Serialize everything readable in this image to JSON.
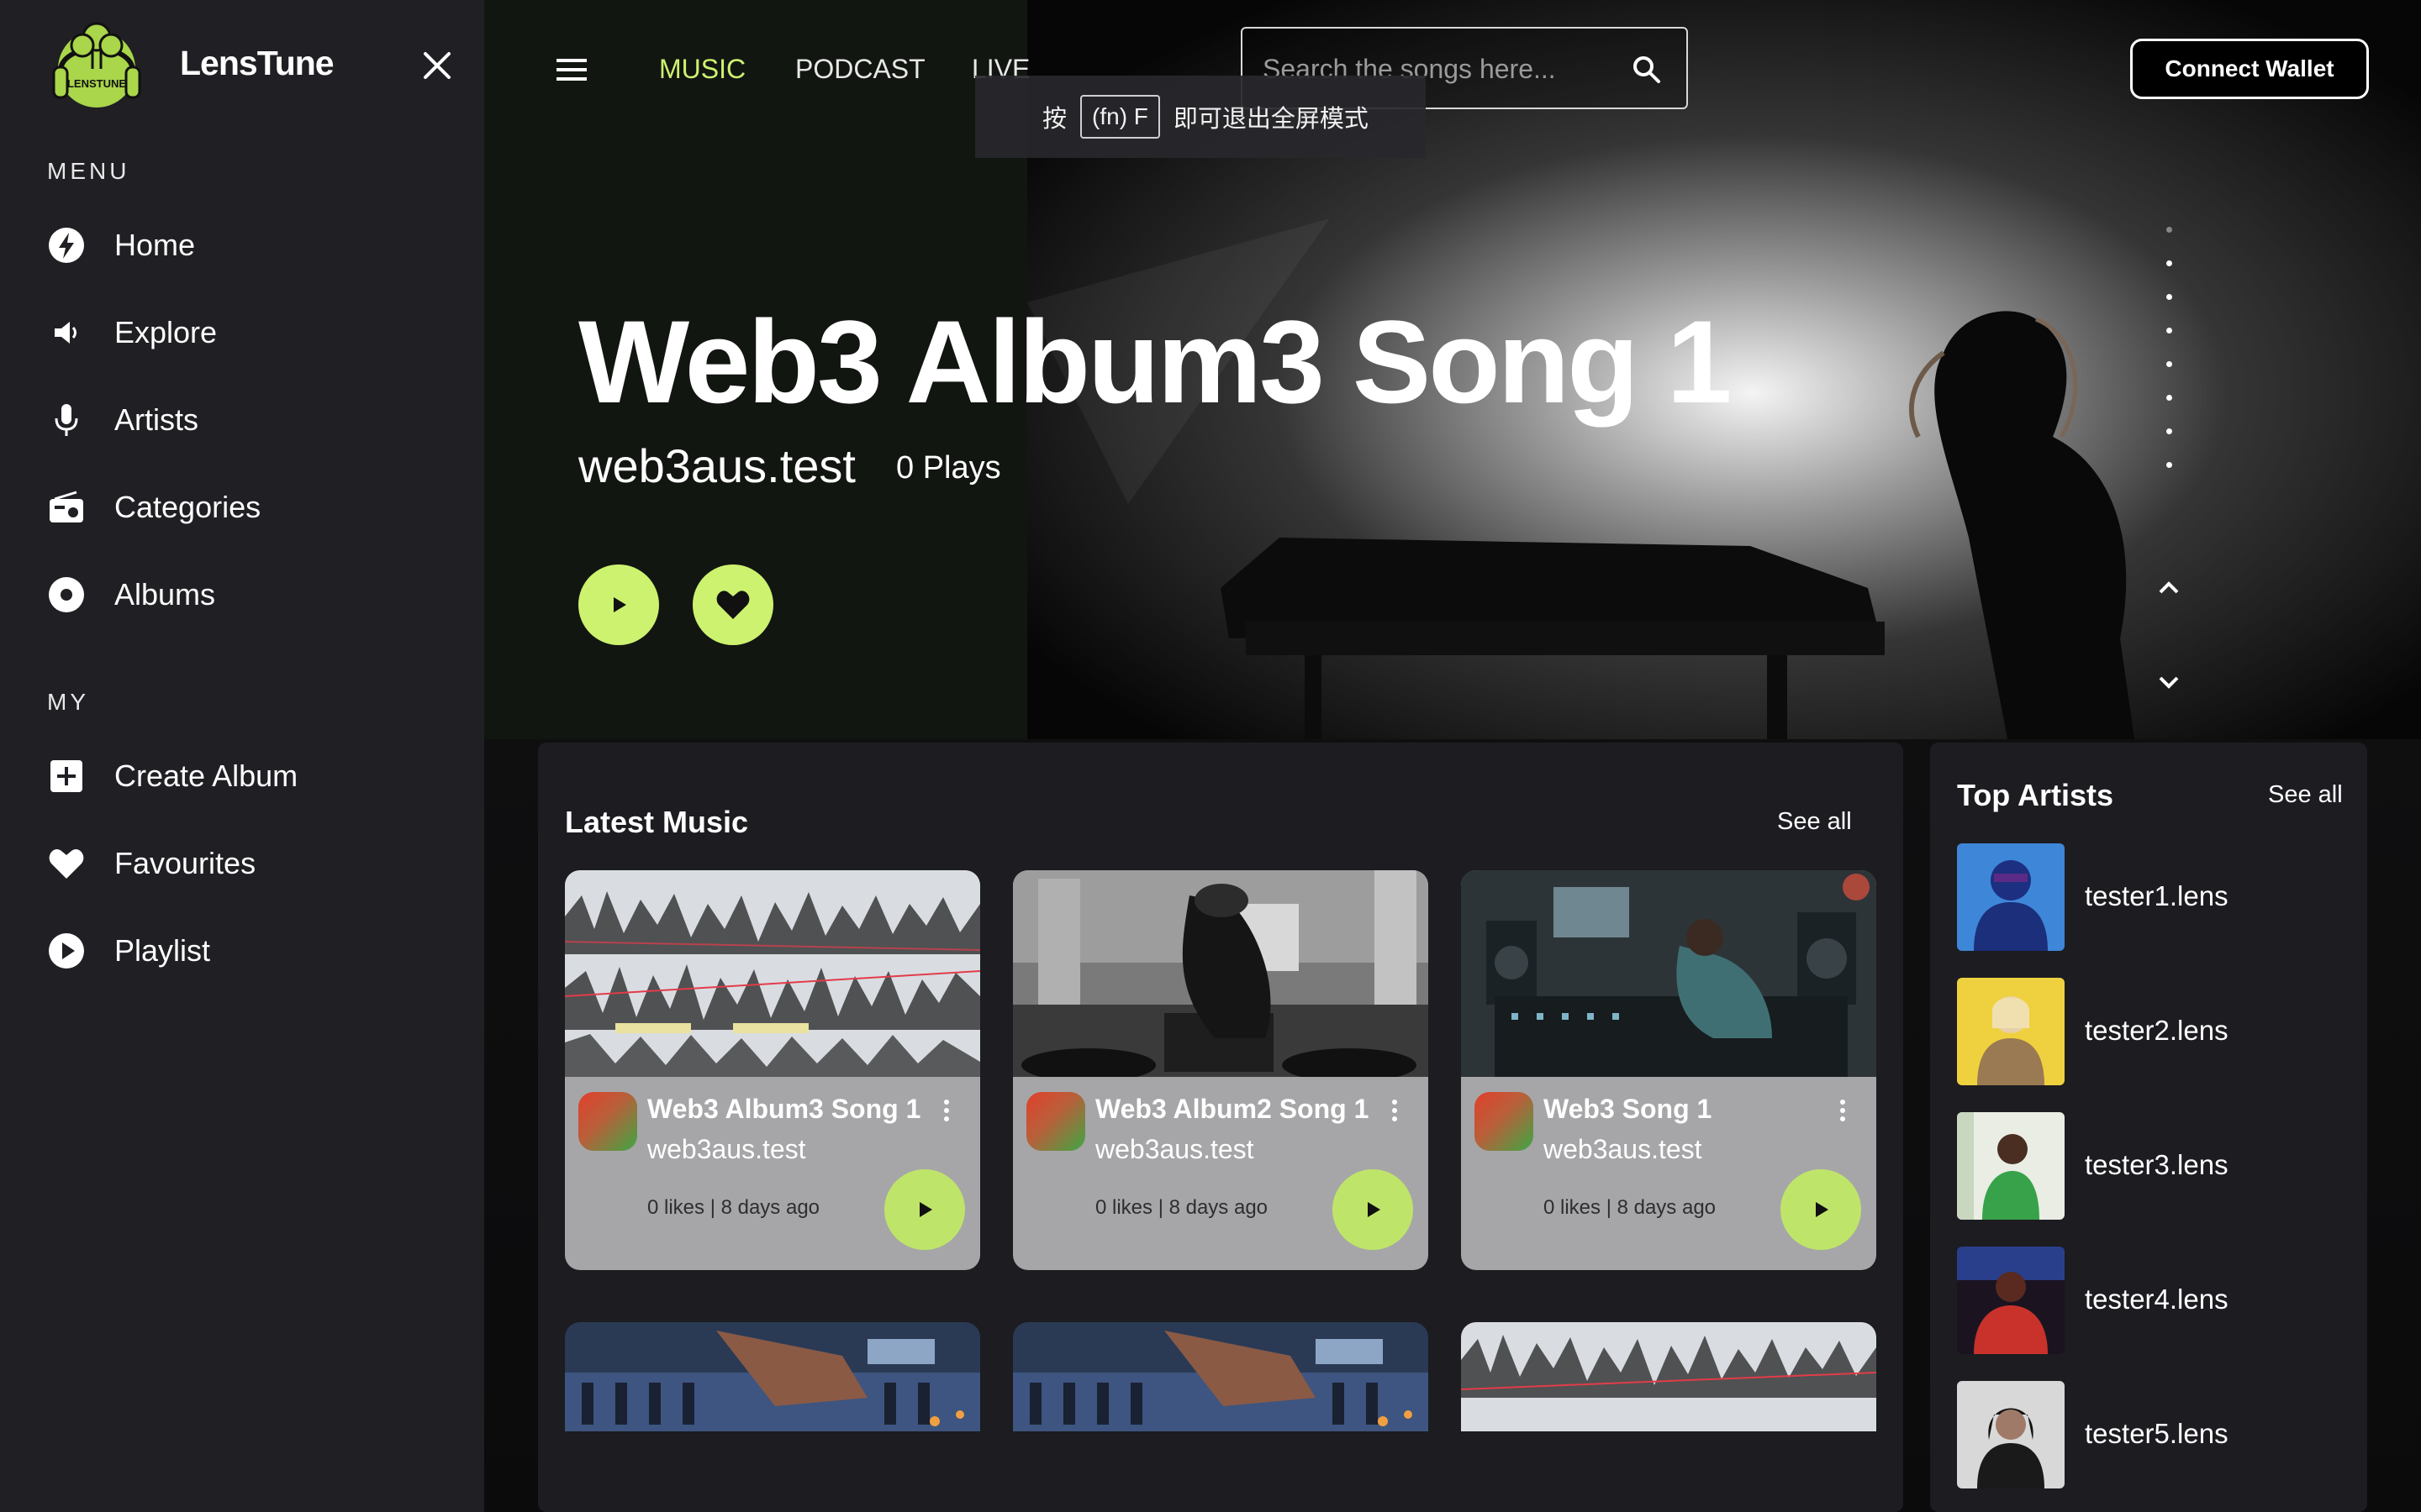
{
  "app": {
    "brand": "LensTune",
    "logo_text": "LENSTUNE"
  },
  "sidebar": {
    "menu_label": "MENU",
    "menu_items": [
      {
        "label": "Home",
        "icon": "bolt-icon"
      },
      {
        "label": "Explore",
        "icon": "speaker-icon"
      },
      {
        "label": "Artists",
        "icon": "microphone-icon"
      },
      {
        "label": "Categories",
        "icon": "radio-icon"
      },
      {
        "label": "Albums",
        "icon": "disc-icon"
      }
    ],
    "my_label": "MY",
    "my_items": [
      {
        "label": "Create Album",
        "icon": "add-box-icon"
      },
      {
        "label": "Favourites",
        "icon": "heart-icon"
      },
      {
        "label": "Playlist",
        "icon": "play-circle-icon"
      }
    ]
  },
  "header": {
    "tabs": [
      {
        "label": "MUSIC",
        "active": true
      },
      {
        "label": "PODCAST",
        "active": false
      },
      {
        "label": "LIVE",
        "active": false
      }
    ],
    "search_placeholder": "Search the songs here...",
    "connect_wallet": "Connect Wallet"
  },
  "fullscreen_toast": {
    "prefix": "按",
    "key": "(fn) F",
    "suffix": "即可退出全屏模式"
  },
  "hero": {
    "title": "Web3 Album3 Song 1",
    "artist": "web3aus.test",
    "plays": "0 Plays",
    "slide_count": 8,
    "active_slide": 0
  },
  "latest_music": {
    "title": "Latest Music",
    "see_all": "See all",
    "cards": [
      {
        "title": "Web3 Album3 Song 1",
        "artist": "web3aus.test",
        "meta": "0 likes | 8 days ago"
      },
      {
        "title": "Web3 Album2 Song 1",
        "artist": "web3aus.test",
        "meta": "0 likes | 8 days ago"
      },
      {
        "title": "Web3 Song 1",
        "artist": "web3aus.test",
        "meta": "0 likes | 8 days ago"
      }
    ]
  },
  "top_artists": {
    "title": "Top Artists",
    "see_all": "See all",
    "items": [
      {
        "name": "tester1.lens"
      },
      {
        "name": "tester2.lens"
      },
      {
        "name": "tester3.lens"
      },
      {
        "name": "tester4.lens"
      },
      {
        "name": "tester5.lens"
      }
    ]
  },
  "colors": {
    "accent": "#cdf26f",
    "sidebar_bg": "#1f1f24",
    "panel_bg": "#1c1c21",
    "card_bg": "#a6a6a8"
  }
}
